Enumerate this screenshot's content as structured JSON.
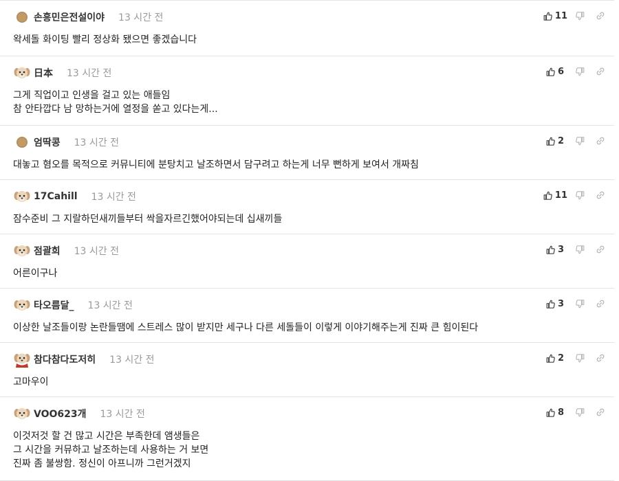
{
  "comments": [
    {
      "nickname": "손흥민은전설이야",
      "avatar": "level-coin-icon",
      "time": "13 시간 전",
      "likes": "11",
      "lines": [
        "왁세돌 화이팅 빨리 정상화 됐으면 좋겠습니다"
      ]
    },
    {
      "nickname": "日本",
      "avatar": "puppy-icon",
      "time": "13 시간 전",
      "likes": "6",
      "lines": [
        "그게 직업이고 인생을 걸고 있는 애들임",
        "참 안타깝다 남 망하는거에 열정을 쏟고 있다는게..."
      ]
    },
    {
      "nickname": "엄딱콩",
      "avatar": "level-coin-icon",
      "time": "13 시간 전",
      "likes": "2",
      "lines": [
        "대놓고 혐오를 목적으로 커뮤니티에 분탕치고 날조하면서 담구려고 하는게 너무 뻔하게 보여서 개짜침"
      ]
    },
    {
      "nickname": "17Cahill",
      "avatar": "puppy-icon",
      "time": "13 시간 전",
      "likes": "11",
      "lines": [
        "잠수준비 그 지랄하던새끼들부터 싹을자르긴했어야되는데 십새끼들"
      ]
    },
    {
      "nickname": "점괄희",
      "avatar": "puppy-icon",
      "time": "13 시간 전",
      "likes": "3",
      "lines": [
        "어른이구나"
      ]
    },
    {
      "nickname": "타오름달_",
      "avatar": "puppy-icon",
      "time": "13 시간 전",
      "likes": "3",
      "lines": [
        "이상한 날조들이랑 논란들땜에 스트레스 많이 받지만 세구나 다른 세돌들이 이렇게 이야기해주는게 진짜 큰 힘이된다"
      ]
    },
    {
      "nickname": "참다참다도저히",
      "avatar": "puppy-scarf-icon",
      "time": "13 시간 전",
      "likes": "2",
      "lines": [
        "고마우이"
      ]
    },
    {
      "nickname": "VOO623개",
      "avatar": "puppy-icon",
      "time": "13 시간 전",
      "likes": "8",
      "lines": [
        "이것저것 할 건 많고 시간은 부족한데 앰생들은",
        "그 시간을 커뮤하고 날조하는데 사용하는 거 보면",
        "진짜 좀 불쌍함. 정신이 아프니까 그런거겠지"
      ]
    }
  ]
}
